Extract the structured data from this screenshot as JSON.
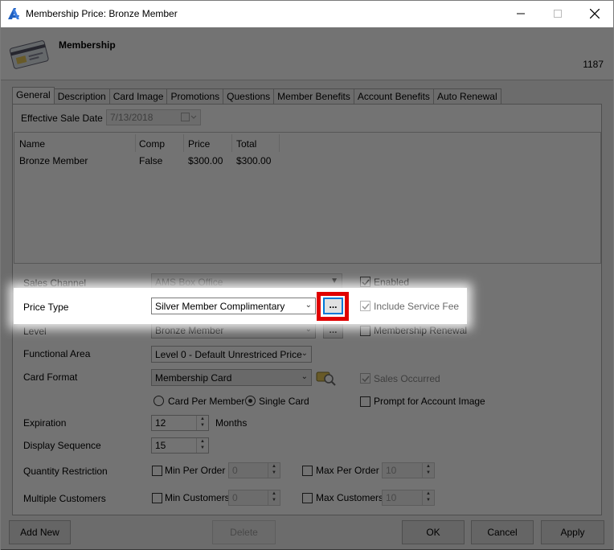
{
  "window": {
    "title": "Membership Price: Bronze Member",
    "minimize_icon": "minimize-icon",
    "maximize_icon": "maximize-icon",
    "close_icon": "close-icon"
  },
  "header": {
    "title": "Membership",
    "id": "1187",
    "icon": "membership-card-icon"
  },
  "tabs": [
    "General",
    "Description",
    "Card Image",
    "Promotions",
    "Questions",
    "Member Benefits",
    "Account Benefits",
    "Auto Renewal"
  ],
  "general": {
    "effective_sale_date_label": "Effective Sale Date",
    "effective_sale_date": "7/13/2018",
    "grid": {
      "columns": [
        "Name",
        "Comp",
        "Price",
        "Total"
      ],
      "rows": [
        {
          "name": "Bronze Member",
          "comp": "False",
          "price": "$300.00",
          "total": "$300.00"
        }
      ]
    },
    "sales_channel_label": "Sales Channel",
    "sales_channel": "AMS Box Office",
    "price_type_label": "Price Type",
    "price_type": "Silver Member Complimentary",
    "level_label": "Level",
    "level": "Bronze Member",
    "functional_area_label": "Functional Area",
    "functional_area": "Level 0 - Default Unrestriced Price",
    "card_format_label": "Card Format",
    "card_format": "Membership Card",
    "card_per_member_label": "Card Per Member",
    "single_card_label": "Single Card",
    "expiration_label": "Expiration",
    "expiration": "12",
    "expiration_unit": "Months",
    "display_sequence_label": "Display Sequence",
    "display_sequence": "15",
    "quantity_restriction_label": "Quantity Restriction",
    "min_per_order_label": "Min Per Order",
    "min_per_order": "0",
    "max_per_order_label": "Max Per Order",
    "max_per_order": "10",
    "multiple_customers_label": "Multiple Customers",
    "min_customers_label": "Min Customers",
    "min_customers": "0",
    "max_customers_label": "Max Customers",
    "max_customers": "10",
    "enabled_label": "Enabled",
    "include_service_fee_label": "Include Service Fee",
    "membership_renewal_label": "Membership Renewal",
    "sales_occurred_label": "Sales Occurred",
    "prompt_account_image_label": "Prompt for Account Image",
    "ellipsis": "..."
  },
  "footer": {
    "add_new": "Add New",
    "delete": "Delete",
    "ok": "OK",
    "cancel": "Cancel",
    "apply": "Apply"
  },
  "colors": {
    "highlight_box": "#e00000",
    "focus_border": "#0078d7",
    "app_icon": "#1f5fbf"
  }
}
